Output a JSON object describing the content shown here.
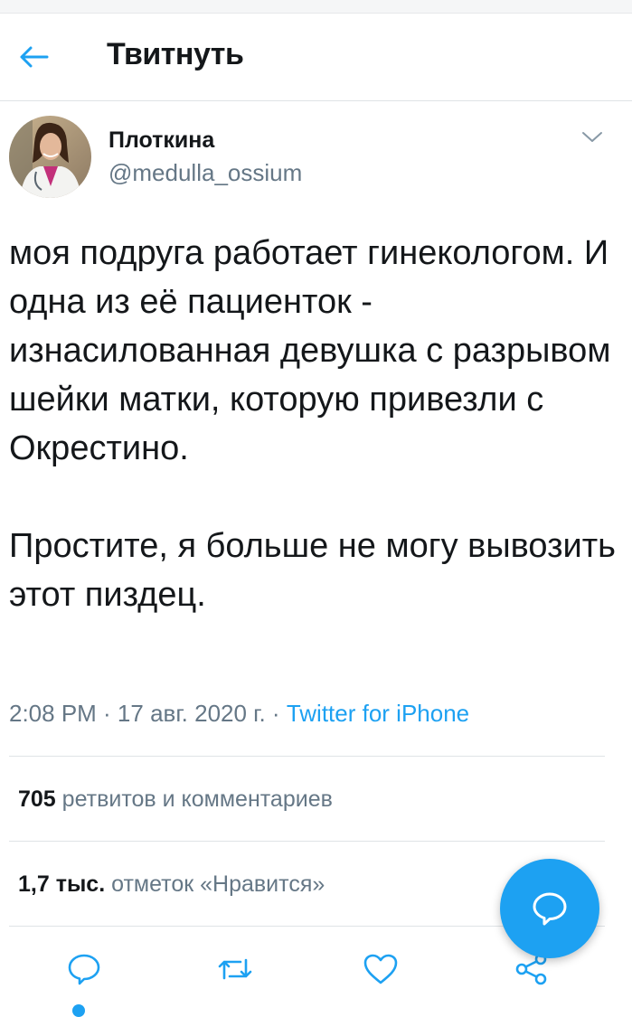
{
  "header": {
    "title": "Твитнуть",
    "back_icon": "arrow-left-icon"
  },
  "tweet": {
    "author_name": "Плоткина",
    "author_handle": "@medulla_ossium",
    "text": "моя подруга работает гинекологом. И одна из её пациенток - изнасилованная девушка с разрывом шейки матки, которую привезли с Окрестино.\n\nПростите, я больше не могу вывозить этот пиздец.",
    "time": "2:08 PM · 17 авг. 2020 г. · ",
    "source": "Twitter for iPhone"
  },
  "stats": {
    "retweets_count": "705",
    "retweets_label": "ретвитов и комментариев",
    "likes_count": "1,7 тыс.",
    "likes_label": "отметок «Нравится»"
  },
  "actions": [
    "reply-icon",
    "retweet-icon",
    "like-icon",
    "share-icon"
  ],
  "fab": {
    "icon": "compose-reply-icon"
  },
  "colors": {
    "accent": "#1da1f2",
    "text": "#14171a",
    "secondary": "#657786",
    "divider": "#dfe3e6"
  }
}
